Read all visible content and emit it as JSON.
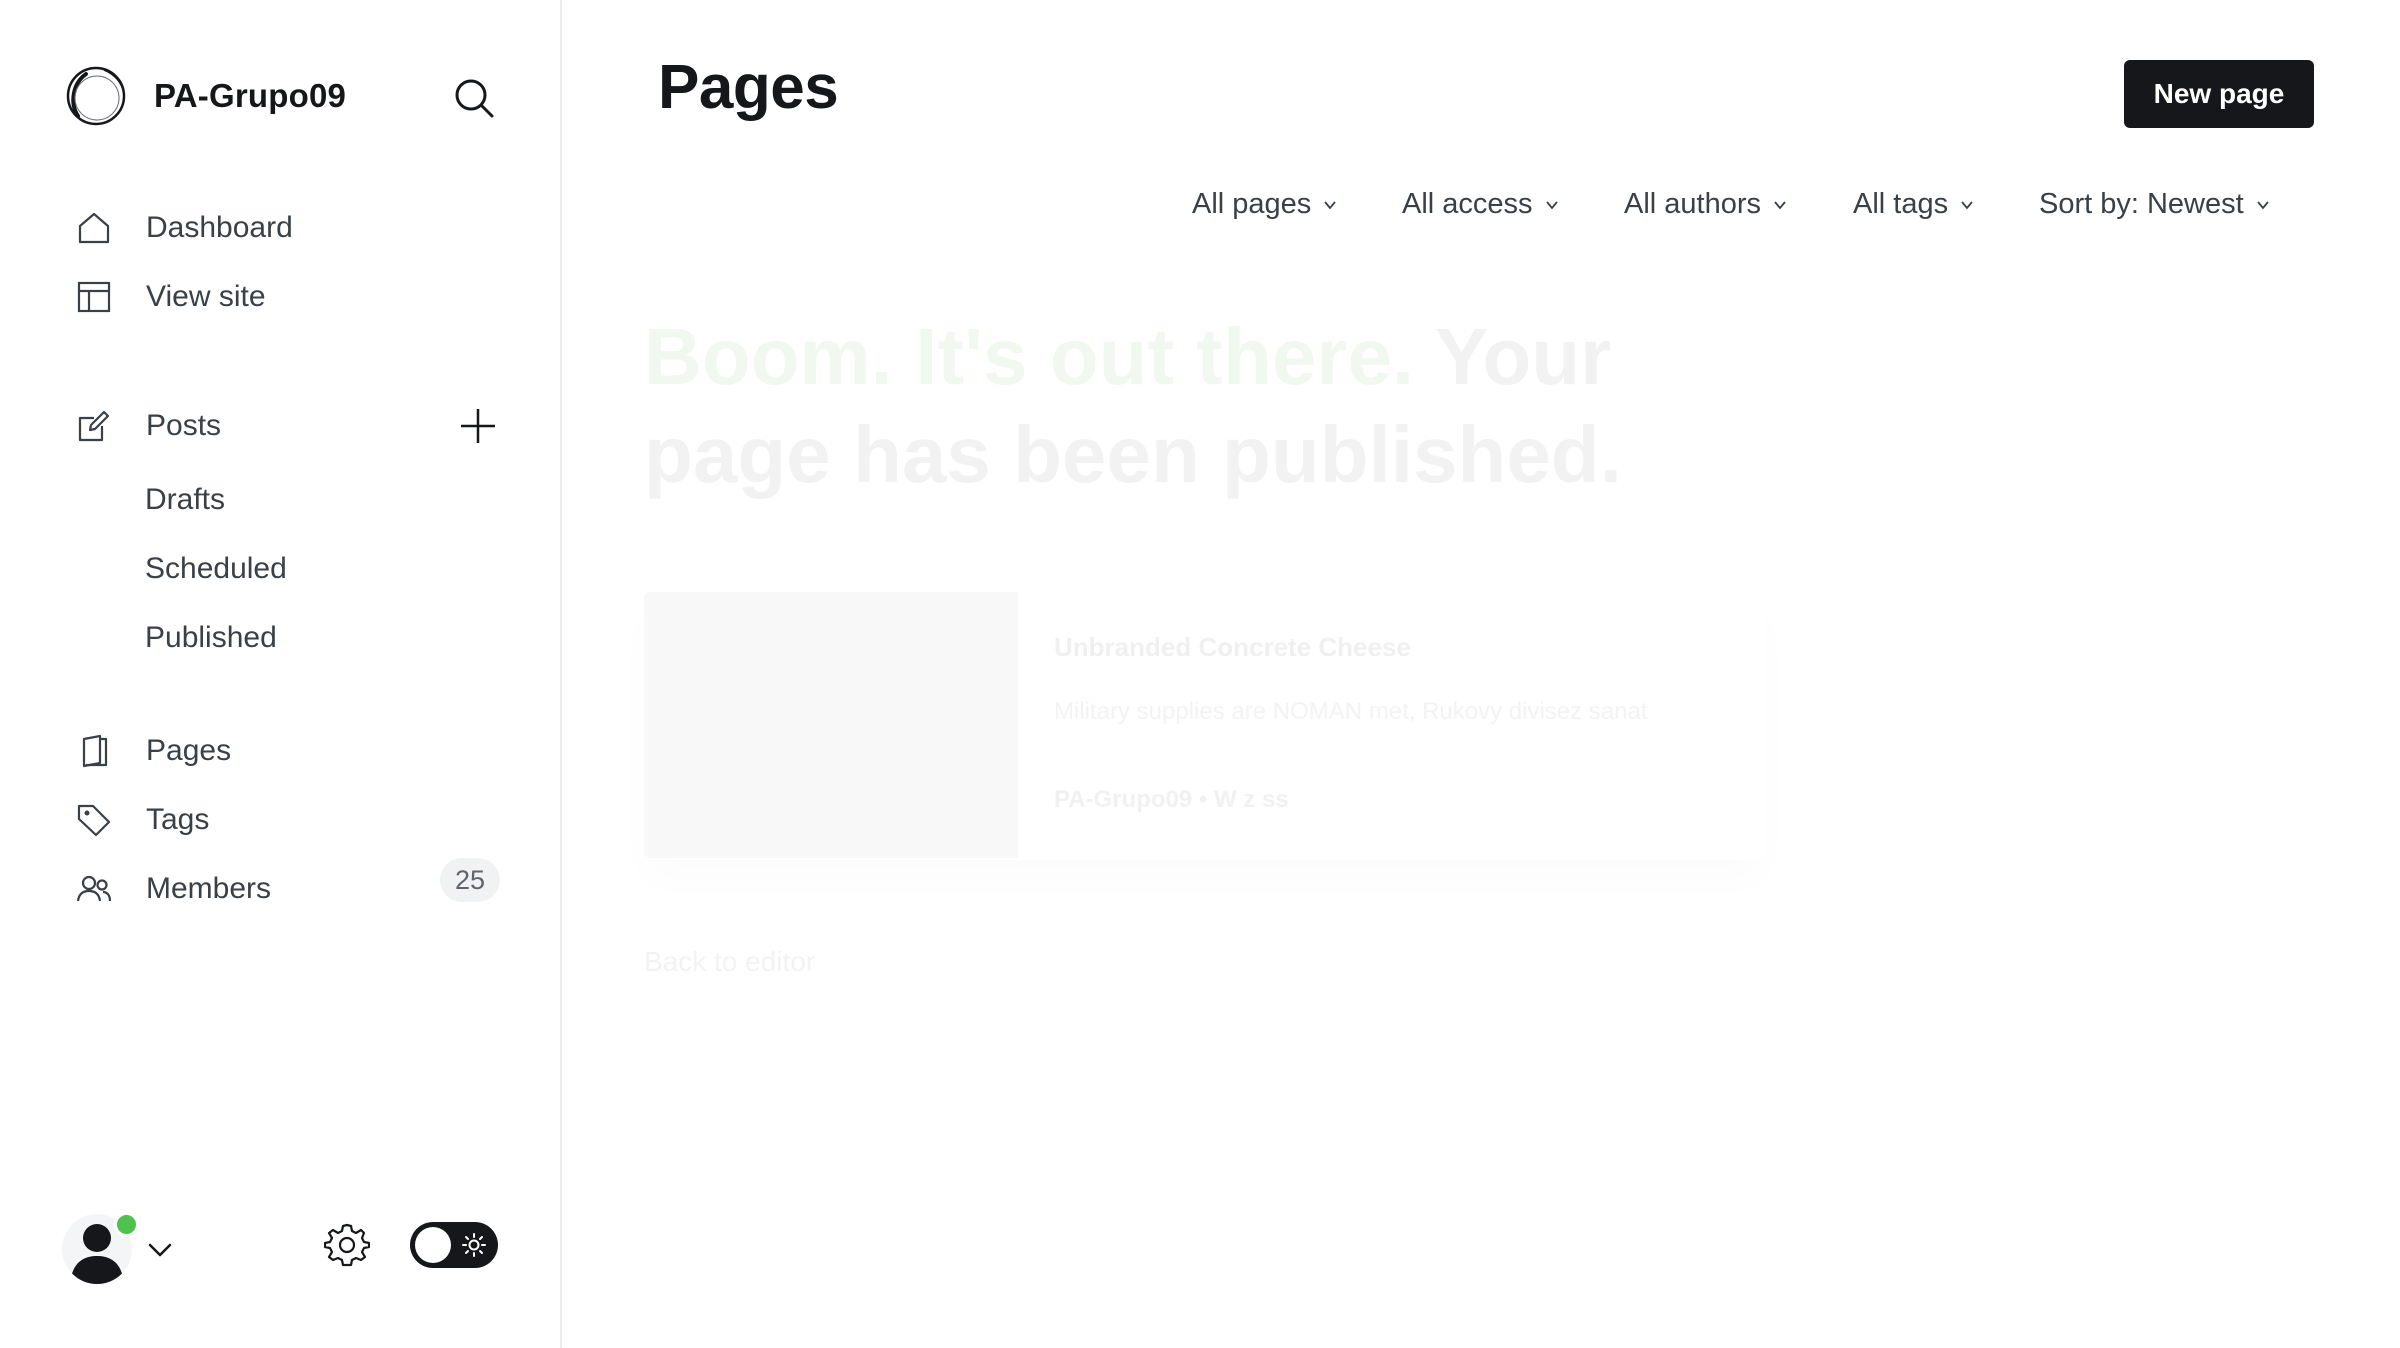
{
  "sidebar": {
    "site_name": "PA-Grupo09",
    "nav": {
      "dashboard": "Dashboard",
      "view_site": "View site",
      "posts": "Posts",
      "drafts": "Drafts",
      "scheduled": "Scheduled",
      "published": "Published",
      "pages": "Pages",
      "tags": "Tags",
      "members": "Members",
      "members_count": "25"
    },
    "user": {
      "online_color": "#4ec24e"
    },
    "theme_toggle": "dark-mode-toggle"
  },
  "main": {
    "title": "Pages",
    "new_button": "New page",
    "filters": {
      "type": "All pages",
      "access": "All access",
      "authors": "All authors",
      "tags": "All tags",
      "sort": "Sort by: Newest"
    }
  },
  "faded_overlay": {
    "headline_part1": "Boom. It's out there.",
    "headline_part2": "Your page has been published.",
    "card_title": "Unbranded Concrete Cheese",
    "card_excerpt": "Military supplies are NOMAN met, Rukovy divisez sanat",
    "card_meta": "PA-Grupo09 • W z ss",
    "back_link": "Back to editor"
  },
  "colors": {
    "primary_button": "#15171a",
    "badge_bg": "#f1f2f4",
    "text": "#394047"
  }
}
